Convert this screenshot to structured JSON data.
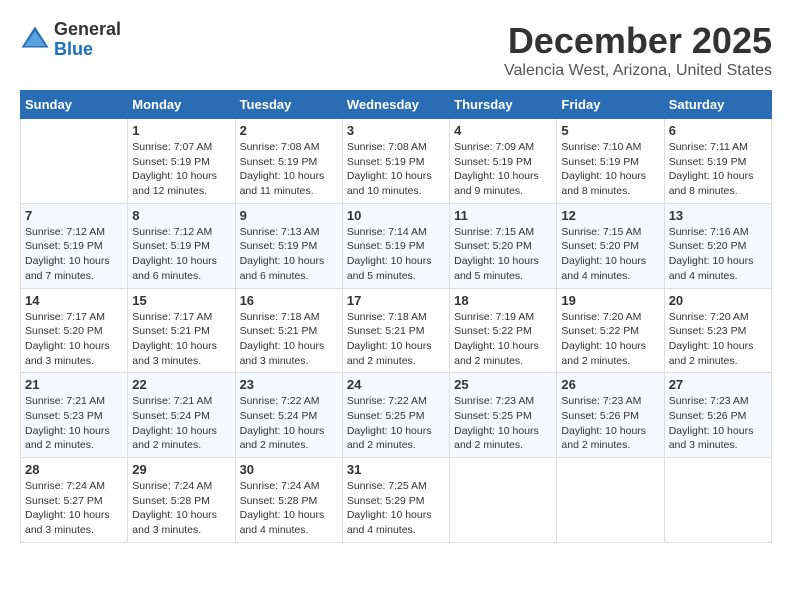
{
  "logo": {
    "general": "General",
    "blue": "Blue"
  },
  "title": "December 2025",
  "subtitle": "Valencia West, Arizona, United States",
  "days_of_week": [
    "Sunday",
    "Monday",
    "Tuesday",
    "Wednesday",
    "Thursday",
    "Friday",
    "Saturday"
  ],
  "weeks": [
    [
      {
        "day": "",
        "info": ""
      },
      {
        "day": "1",
        "info": "Sunrise: 7:07 AM\nSunset: 5:19 PM\nDaylight: 10 hours\nand 12 minutes."
      },
      {
        "day": "2",
        "info": "Sunrise: 7:08 AM\nSunset: 5:19 PM\nDaylight: 10 hours\nand 11 minutes."
      },
      {
        "day": "3",
        "info": "Sunrise: 7:08 AM\nSunset: 5:19 PM\nDaylight: 10 hours\nand 10 minutes."
      },
      {
        "day": "4",
        "info": "Sunrise: 7:09 AM\nSunset: 5:19 PM\nDaylight: 10 hours\nand 9 minutes."
      },
      {
        "day": "5",
        "info": "Sunrise: 7:10 AM\nSunset: 5:19 PM\nDaylight: 10 hours\nand 8 minutes."
      },
      {
        "day": "6",
        "info": "Sunrise: 7:11 AM\nSunset: 5:19 PM\nDaylight: 10 hours\nand 8 minutes."
      }
    ],
    [
      {
        "day": "7",
        "info": "Sunrise: 7:12 AM\nSunset: 5:19 PM\nDaylight: 10 hours\nand 7 minutes."
      },
      {
        "day": "8",
        "info": "Sunrise: 7:12 AM\nSunset: 5:19 PM\nDaylight: 10 hours\nand 6 minutes."
      },
      {
        "day": "9",
        "info": "Sunrise: 7:13 AM\nSunset: 5:19 PM\nDaylight: 10 hours\nand 6 minutes."
      },
      {
        "day": "10",
        "info": "Sunrise: 7:14 AM\nSunset: 5:19 PM\nDaylight: 10 hours\nand 5 minutes."
      },
      {
        "day": "11",
        "info": "Sunrise: 7:15 AM\nSunset: 5:20 PM\nDaylight: 10 hours\nand 5 minutes."
      },
      {
        "day": "12",
        "info": "Sunrise: 7:15 AM\nSunset: 5:20 PM\nDaylight: 10 hours\nand 4 minutes."
      },
      {
        "day": "13",
        "info": "Sunrise: 7:16 AM\nSunset: 5:20 PM\nDaylight: 10 hours\nand 4 minutes."
      }
    ],
    [
      {
        "day": "14",
        "info": "Sunrise: 7:17 AM\nSunset: 5:20 PM\nDaylight: 10 hours\nand 3 minutes."
      },
      {
        "day": "15",
        "info": "Sunrise: 7:17 AM\nSunset: 5:21 PM\nDaylight: 10 hours\nand 3 minutes."
      },
      {
        "day": "16",
        "info": "Sunrise: 7:18 AM\nSunset: 5:21 PM\nDaylight: 10 hours\nand 3 minutes."
      },
      {
        "day": "17",
        "info": "Sunrise: 7:18 AM\nSunset: 5:21 PM\nDaylight: 10 hours\nand 2 minutes."
      },
      {
        "day": "18",
        "info": "Sunrise: 7:19 AM\nSunset: 5:22 PM\nDaylight: 10 hours\nand 2 minutes."
      },
      {
        "day": "19",
        "info": "Sunrise: 7:20 AM\nSunset: 5:22 PM\nDaylight: 10 hours\nand 2 minutes."
      },
      {
        "day": "20",
        "info": "Sunrise: 7:20 AM\nSunset: 5:23 PM\nDaylight: 10 hours\nand 2 minutes."
      }
    ],
    [
      {
        "day": "21",
        "info": "Sunrise: 7:21 AM\nSunset: 5:23 PM\nDaylight: 10 hours\nand 2 minutes."
      },
      {
        "day": "22",
        "info": "Sunrise: 7:21 AM\nSunset: 5:24 PM\nDaylight: 10 hours\nand 2 minutes."
      },
      {
        "day": "23",
        "info": "Sunrise: 7:22 AM\nSunset: 5:24 PM\nDaylight: 10 hours\nand 2 minutes."
      },
      {
        "day": "24",
        "info": "Sunrise: 7:22 AM\nSunset: 5:25 PM\nDaylight: 10 hours\nand 2 minutes."
      },
      {
        "day": "25",
        "info": "Sunrise: 7:23 AM\nSunset: 5:25 PM\nDaylight: 10 hours\nand 2 minutes."
      },
      {
        "day": "26",
        "info": "Sunrise: 7:23 AM\nSunset: 5:26 PM\nDaylight: 10 hours\nand 2 minutes."
      },
      {
        "day": "27",
        "info": "Sunrise: 7:23 AM\nSunset: 5:26 PM\nDaylight: 10 hours\nand 3 minutes."
      }
    ],
    [
      {
        "day": "28",
        "info": "Sunrise: 7:24 AM\nSunset: 5:27 PM\nDaylight: 10 hours\nand 3 minutes."
      },
      {
        "day": "29",
        "info": "Sunrise: 7:24 AM\nSunset: 5:28 PM\nDaylight: 10 hours\nand 3 minutes."
      },
      {
        "day": "30",
        "info": "Sunrise: 7:24 AM\nSunset: 5:28 PM\nDaylight: 10 hours\nand 4 minutes."
      },
      {
        "day": "31",
        "info": "Sunrise: 7:25 AM\nSunset: 5:29 PM\nDaylight: 10 hours\nand 4 minutes."
      },
      {
        "day": "",
        "info": ""
      },
      {
        "day": "",
        "info": ""
      },
      {
        "day": "",
        "info": ""
      }
    ]
  ]
}
